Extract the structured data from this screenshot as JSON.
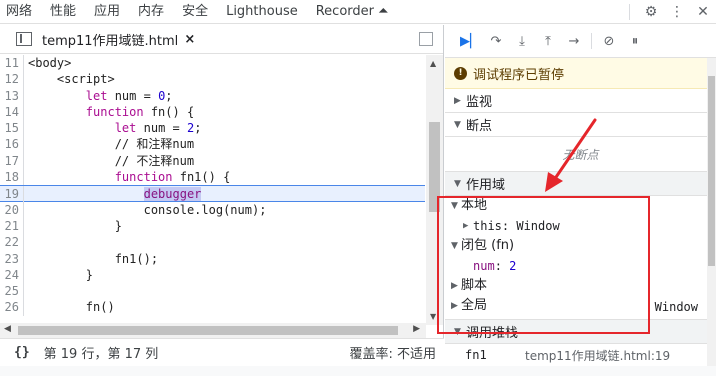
{
  "topbar": {
    "tabs": [
      "网络",
      "性能",
      "应用",
      "内存",
      "安全",
      "Lighthouse",
      "Recorder ⏶"
    ],
    "icons": [
      "gear-icon",
      "more-vertical-icon",
      "close-icon"
    ]
  },
  "editor": {
    "file_name": "temp11作用域链.html",
    "close_symbol": "×",
    "lines": [
      {
        "n": "11",
        "t": "<body>"
      },
      {
        "n": "12",
        "t": "    <script>"
      },
      {
        "n": "13",
        "t": "        let num = 0;"
      },
      {
        "n": "14",
        "t": "        function fn() {"
      },
      {
        "n": "15",
        "t": "            let num = 2;"
      },
      {
        "n": "16",
        "t": "            // 和注释num"
      },
      {
        "n": "17",
        "t": "            // 不注释num"
      },
      {
        "n": "18",
        "t": "            function fn1() {"
      },
      {
        "n": "19",
        "t": "                debugger"
      },
      {
        "n": "20",
        "t": "                console.log(num);"
      },
      {
        "n": "21",
        "t": "            }"
      },
      {
        "n": "22",
        "t": ""
      },
      {
        "n": "23",
        "t": "            fn1();"
      },
      {
        "n": "24",
        "t": "        }"
      },
      {
        "n": "25",
        "t": ""
      },
      {
        "n": "26",
        "t": "        fn()"
      }
    ]
  },
  "statusbar": {
    "braces": "{}",
    "position": "第 19 行，第 17 列",
    "coverage": "覆盖率: 不适用"
  },
  "debugger": {
    "paused_label": "调试程序已暂停",
    "watch_label": "监视",
    "breakpoints_label": "断点",
    "no_breakpoints": "无断点",
    "scope_label": "作用域",
    "scope": {
      "local_label": "本地",
      "this_key": "this",
      "this_value": "Window",
      "closure_label": "闭包 (fn)",
      "num_key": "num",
      "num_value": "2",
      "script_label": "脚本",
      "global_label": "全局",
      "global_value": "Window"
    },
    "callstack_label": "调用堆栈",
    "callstack": [
      {
        "fn": "fn1",
        "loc": "temp11作用域链.html:19"
      }
    ]
  },
  "colors": {
    "annotation": "#e5262b",
    "highlight_line": "#e8f0fe",
    "paused_bg": "#fffbe5"
  }
}
